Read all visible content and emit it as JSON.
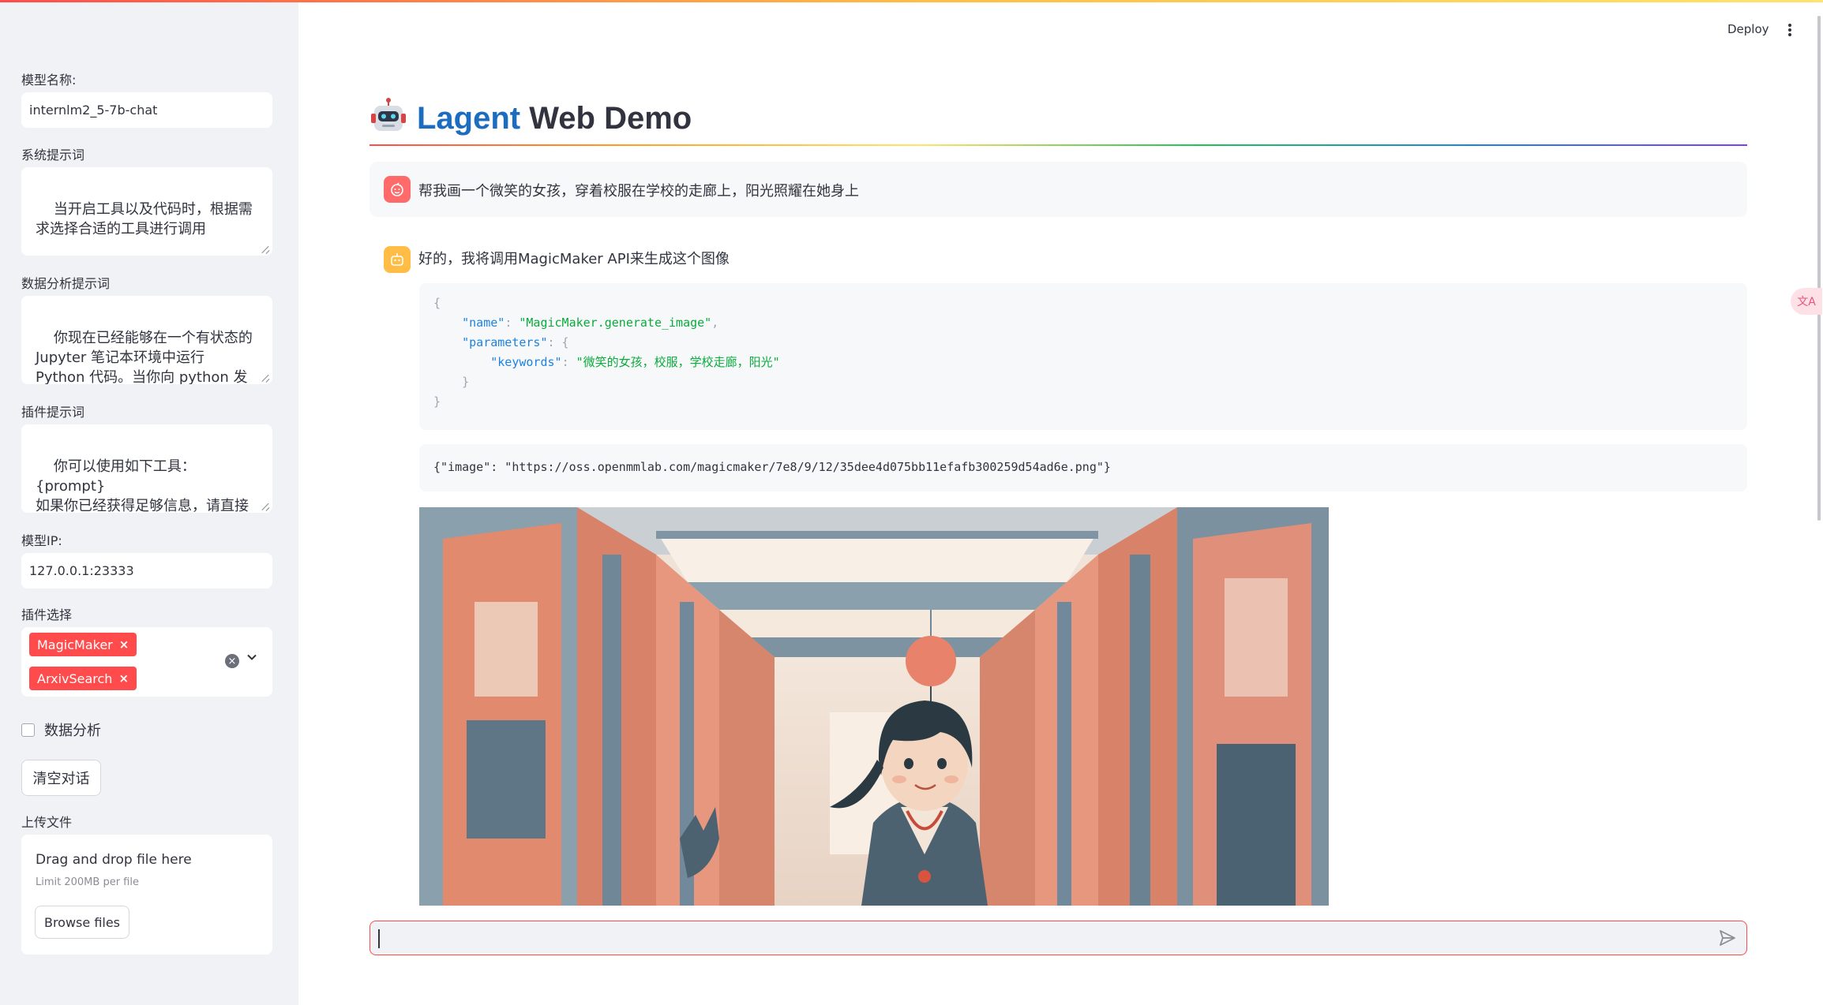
{
  "header": {
    "deploy_label": "Deploy",
    "title_accent": "Lagent",
    "title_rest": "Web Demo"
  },
  "sidebar": {
    "model_name_label": "模型名称:",
    "model_name_value": "internlm2_5-7b-chat",
    "system_prompt_label": "系统提示词",
    "system_prompt_value": "当开启工具以及代码时，根据需求选择合适的工具进行调用",
    "da_prompt_label": "数据分析提示词",
    "da_prompt_value": "你现在已经能够在一个有状态的 Jupyter 笔记本环境中运行 Python 代码。当你向 python 发送含有 Python 代码的消息时，它将在该环境中执行。",
    "plugin_prompt_label": "插件提示词",
    "plugin_prompt_value": "你可以使用如下工具：\n{prompt}\n如果你已经获得足够信息，请直接给出答案.避免不必要的工具调用!",
    "model_ip_label": "模型IP:",
    "model_ip_value": "127.0.0.1:23333",
    "plugin_select_label": "插件选择",
    "plugin_tags": [
      "MagicMaker",
      "ArxivSearch"
    ],
    "data_analysis_label": "数据分析",
    "data_analysis_checked": false,
    "clear_button": "清空对话",
    "upload_label": "上传文件",
    "upload_drop_text": "Drag and drop file here",
    "upload_limit_text": "Limit 200MB per file",
    "browse_button": "Browse files"
  },
  "chat": {
    "user_message": "帮我画一个微笑的女孩，穿着校服在学校的走廊上，阳光照耀在她身上",
    "assistant_message": "好的，我将调用MagicMaker API来生成这个图像",
    "tool_call": {
      "name_key": "\"name\"",
      "name_value": "\"MagicMaker.generate_image\"",
      "params_key": "\"parameters\"",
      "keywords_key": "\"keywords\"",
      "keywords_value": "\"微笑的女孩，校服，学校走廊，阳光\""
    },
    "tool_result": "{\"image\": \"https://oss.openmmlab.com/magicmaker/7e8/9/12/35dee4d075bb11efafb300259d54ad6e.png\"}",
    "input_placeholder": ""
  },
  "colors": {
    "accent_red": "#ff4b4b",
    "title_blue": "#1c6cc0",
    "sidebar_bg": "#f0f2f6"
  }
}
